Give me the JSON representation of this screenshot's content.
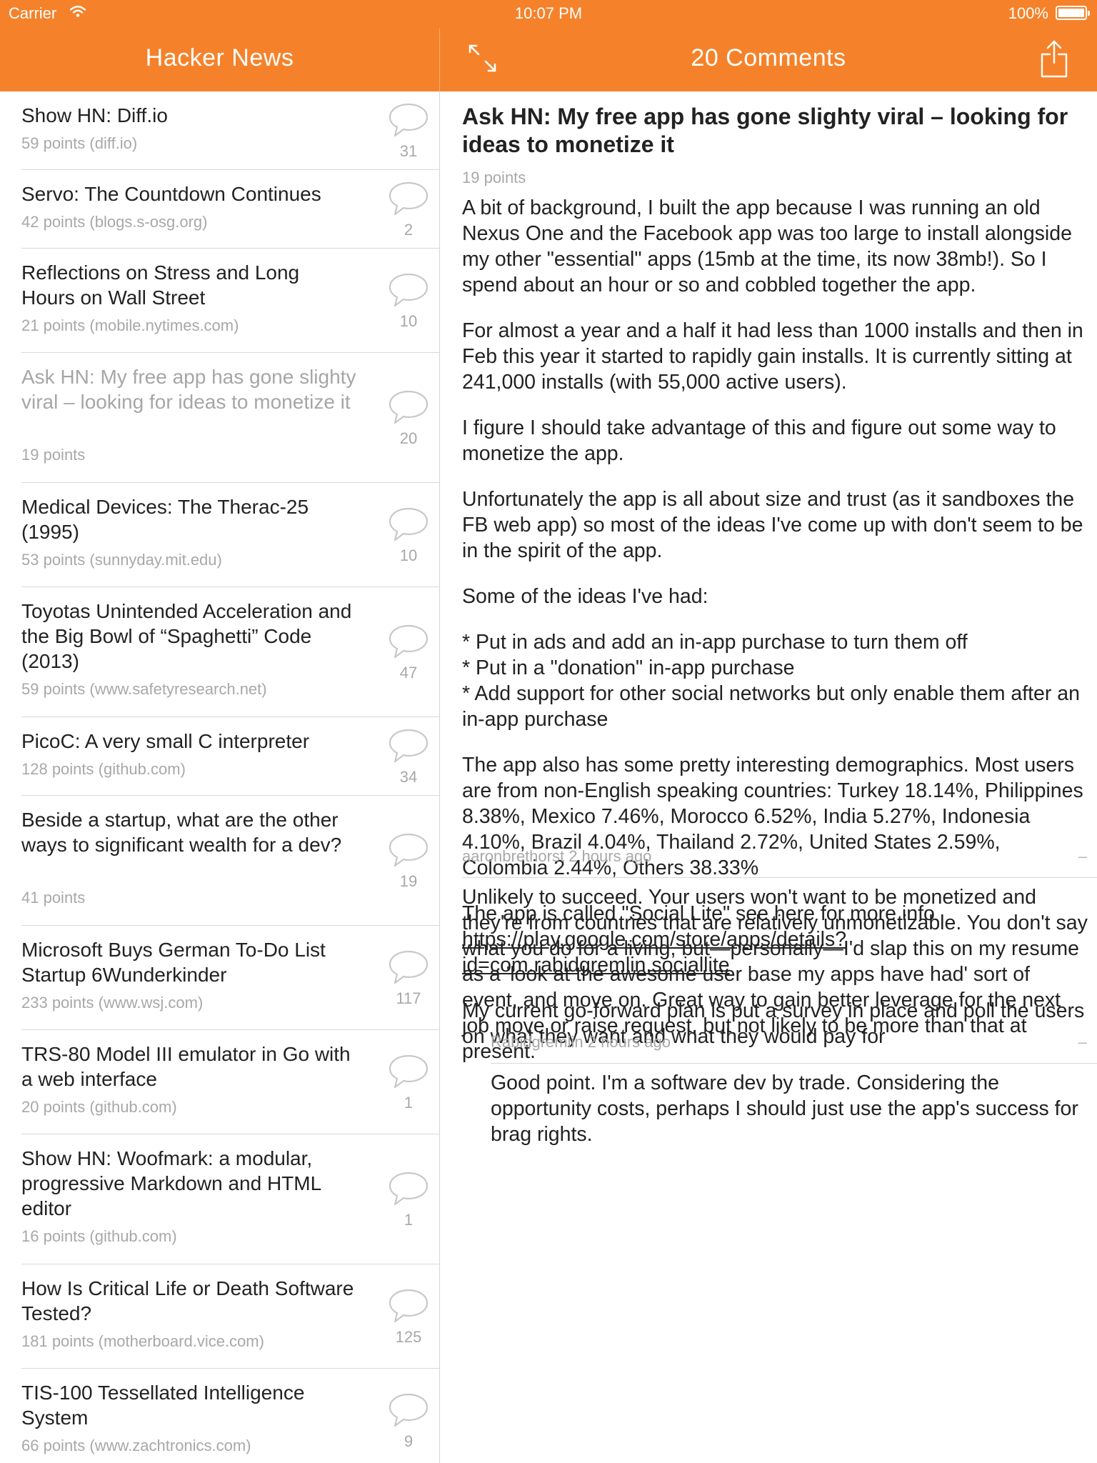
{
  "status_bar": {
    "carrier": "Carrier",
    "time": "10:07 PM",
    "battery": "100%"
  },
  "nav": {
    "left_title": "Hacker News",
    "right_title": "20 Comments"
  },
  "colors": {
    "accent": "#f5822a"
  },
  "icons": {
    "expand": "expand-icon",
    "share": "share-icon",
    "comment": "comment-bubble-icon",
    "wifi": "wifi-icon"
  },
  "stories": [
    {
      "title": "Show HN: Diff.io",
      "meta": "59 points (diff.io)",
      "comments": "31"
    },
    {
      "title": "Servo: The Countdown Continues",
      "meta": "42 points (blogs.s-osg.org)",
      "comments": "2"
    },
    {
      "title": "Reflections on Stress and Long Hours on Wall Street",
      "meta": "21 points (mobile.nytimes.com)",
      "comments": "10"
    },
    {
      "title": "Ask HN: My free app has gone slighty viral – looking for ideas to monetize it",
      "meta": "19 points",
      "comments": "20",
      "read": true
    },
    {
      "title": "Medical Devices: The Therac-25 (1995)",
      "meta": "53 points (sunnyday.mit.edu)",
      "comments": "10"
    },
    {
      "title": "Toyotas Unintended Acceleration and the Big Bowl of “Spaghetti” Code (2013)",
      "meta": "59 points (www.safetyresearch.net)",
      "comments": "47"
    },
    {
      "title": "PicoC: A very small C interpreter",
      "meta": "128 points (github.com)",
      "comments": "34"
    },
    {
      "title": "Beside a startup, what are the other ways to significant wealth for a dev?",
      "meta": "41 points",
      "comments": "19"
    },
    {
      "title": "Microsoft Buys German To-Do List Startup 6Wunderkinder",
      "meta": "233 points (www.wsj.com)",
      "comments": "117"
    },
    {
      "title": "TRS-80 Model III emulator in Go with a web interface",
      "meta": "20 points (github.com)",
      "comments": "1"
    },
    {
      "title": "Show HN: Woofmark: a modular, progressive Markdown and HTML editor",
      "meta": "16 points (github.com)",
      "comments": "1"
    },
    {
      "title": "How Is Critical Life or Death Software Tested?",
      "meta": "181 points (motherboard.vice.com)",
      "comments": "125"
    },
    {
      "title": "TIS-100 Tessellated Intelligence System",
      "meta": "66 points (www.zachtronics.com)",
      "comments": "9"
    }
  ],
  "detail": {
    "title": "Ask HN: My free app has gone slighty viral – looking for ideas to monetize it",
    "points": "19 points",
    "paragraphs": [
      "A bit of background, I built the app because I was running an old Nexus One and the Facebook app was too large to install alongside my other \"essential\" apps (15mb at the time, its now 38mb!). So I spend about an hour or so and cobbled together the app.",
      "For almost a year and a half it had less than 1000 installs and then in Feb this year it started to rapidly gain installs. It is currently sitting at 241,000 installs (with 55,000 active users).",
      "I figure I should take advantage of this and figure out some way to monetize the app.",
      "Unfortunately the app is all about size and trust (as it sandboxes the FB web app) so most of the ideas I've come up with don't seem to be in the spirit of the app.",
      "Some of the ideas I've had:",
      "* Put in ads and add an in-app purchase to turn them off\n* Put in a \"donation\" in-app purchase\n* Add support for other social networks but only enable them after an in-app purchase",
      "The app also has some pretty interesting demographics. Most users are from non-English speaking countries: Turkey 18.14%, Philippines 8.38%, Mexico 7.46%, Morocco 6.52%, India 5.27%, Indonesia 4.10%, Brazil 4.04%, Thailand 2.72%, United States 2.59%, Colombia 2.44%, Others 38.33%"
    ],
    "link_para_prefix": "The app is called \"Social Lite\" see here for more info ",
    "link_text": "https://play.google.com/store/apps/details?id=com.rabidgremlin.sociallite",
    "final_paragraph": "My current go-forward plan is put a survey in place and poll the users on what they want and what they would pay for"
  },
  "comments": [
    {
      "header": "aaronbrethorst 2 hours ago",
      "collapse": "–",
      "text": "Unlikely to succeed. Your users won't want to be monetized and they're from countries that are relatively unmonetizable. You don't say what you do for a living, but—personally—I'd slap this on my resume as a 'look at the awesome user base my apps have had' sort of event, and move on. Great way to gain better leverage for the next job move or raise request, but not likely to be more than that at present."
    },
    {
      "header": "Rabidgremlin 2 hours ago",
      "collapse": "–",
      "text": "Good point. I'm a software dev by trade. Considering the opportunity costs, perhaps I should just use the app's success for brag rights."
    }
  ]
}
